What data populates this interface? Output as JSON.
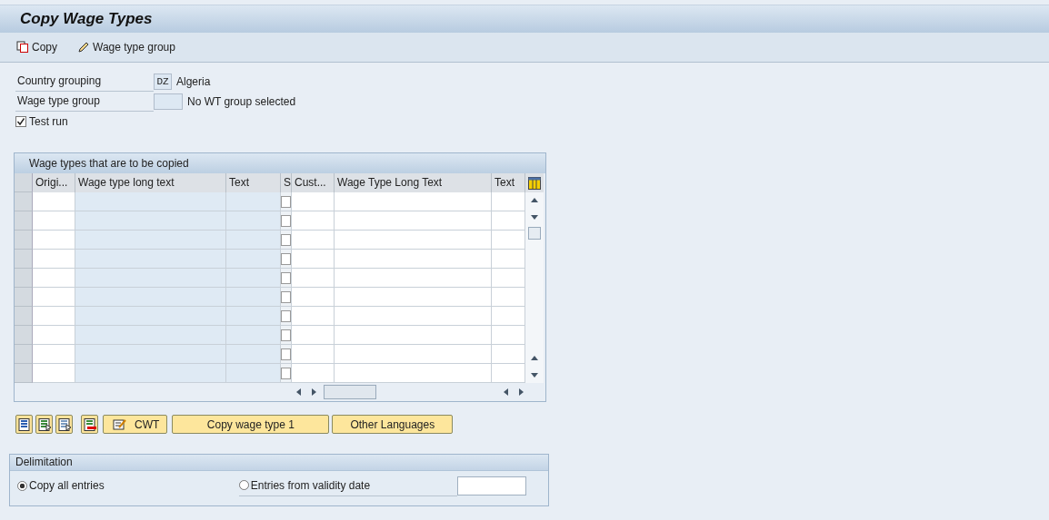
{
  "window": {
    "title": "Copy Wage Types"
  },
  "toolbar": [
    {
      "kind": "copy",
      "label": "Copy"
    },
    {
      "kind": "pencil",
      "label": "Wage type group"
    }
  ],
  "fields": [
    {
      "label": "Country grouping",
      "value": "DZ",
      "description": "Algeria"
    },
    {
      "label": "Wage type group",
      "description": "No WT group selected"
    }
  ],
  "test_run": {
    "label": "Test run",
    "checked": true
  },
  "table": {
    "title": "Wage types that are to be copied",
    "columns": [
      {
        "label": "Origi...",
        "kind": "input"
      },
      {
        "label": "Wage type long text",
        "kind": "display"
      },
      {
        "label": "Text",
        "kind": "display"
      },
      {
        "label": "S",
        "kind": "check"
      },
      {
        "label": "Cust...",
        "kind": "input"
      },
      {
        "label": "Wage Type Long Text",
        "kind": "input"
      },
      {
        "label": "Text",
        "kind": "input"
      }
    ],
    "rows": [
      {
        "selected": false,
        "checked": false
      },
      {
        "selected": false,
        "checked": false
      },
      {
        "selected": false,
        "checked": false
      },
      {
        "selected": false,
        "checked": false
      },
      {
        "selected": false,
        "checked": false
      },
      {
        "selected": false,
        "checked": false
      },
      {
        "selected": false,
        "checked": false
      },
      {
        "selected": false,
        "checked": false
      },
      {
        "selected": false,
        "checked": false
      },
      {
        "selected": false,
        "checked": false
      }
    ]
  },
  "buttons": [
    {
      "kind": "select-all"
    },
    {
      "kind": "select-block"
    },
    {
      "kind": "deselect"
    },
    {
      "kind": "delete"
    },
    {
      "kind": "icon-labeled",
      "label": "CWT"
    },
    {
      "kind": "labeled",
      "label": "Copy wage type 1"
    },
    {
      "kind": "labeled",
      "label": "Other Languages"
    }
  ],
  "delimitation": {
    "title": "Delimitation",
    "options": [
      {
        "label": "Copy all entries",
        "selected": true
      },
      {
        "label": "Entries from validity date",
        "selected": false
      }
    ]
  }
}
